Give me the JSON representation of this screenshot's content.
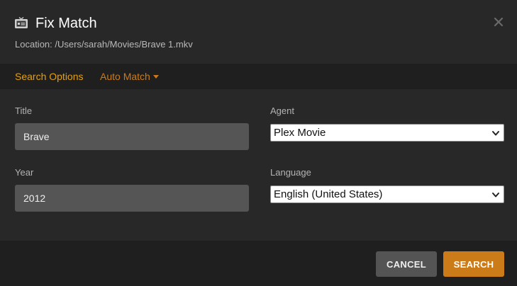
{
  "header": {
    "title": "Fix Match",
    "location": "Location: /Users/sarah/Movies/Brave 1.mkv",
    "icon": "tv-card-icon",
    "close_icon": "close-icon"
  },
  "tabs": [
    {
      "label": "Search Options",
      "active": true
    },
    {
      "label": "Auto Match",
      "has_dropdown": true
    }
  ],
  "form": {
    "title_label": "Title",
    "title_value": "Brave",
    "year_label": "Year",
    "year_value": "2012",
    "agent_label": "Agent",
    "agent_value": "Plex Movie",
    "language_label": "Language",
    "language_value": "English (United States)"
  },
  "footer": {
    "cancel_label": "CANCEL",
    "search_label": "SEARCH"
  },
  "colors": {
    "accent": "#e5a00d",
    "button_primary": "#cc7b19",
    "background": "#282828",
    "bar": "#1f1f1f"
  }
}
